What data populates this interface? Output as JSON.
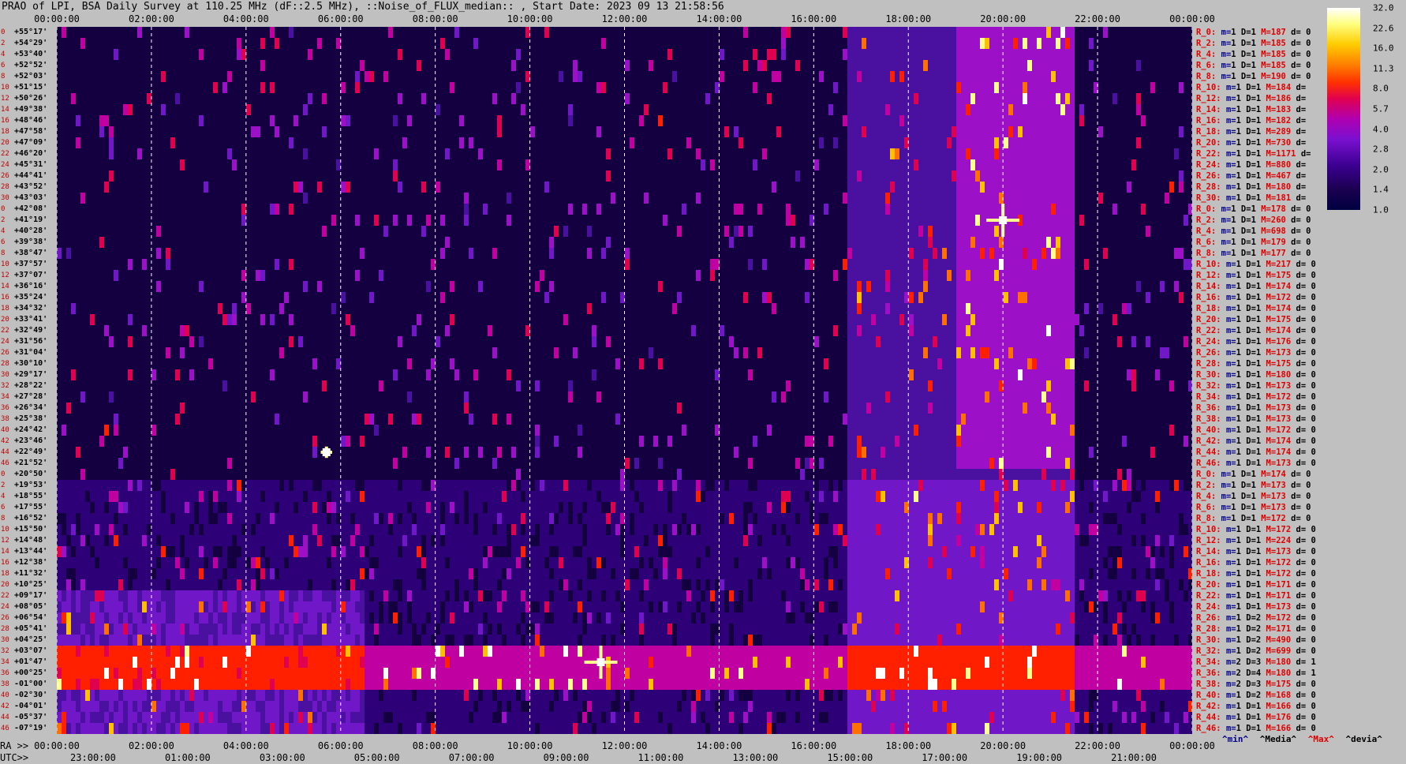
{
  "title": "PRAO of LPI, BSA Daily Survey at 110.25 MHz (dF::2.5 MHz), ::Noise_of_FLUX_median:: , Start Date: 2023 09 13 21:58:56",
  "top_ticks": [
    "00:00:00",
    "02:00:00",
    "04:00:00",
    "06:00:00",
    "08:00:00",
    "10:00:00",
    "12:00:00",
    "14:00:00",
    "16:00:00",
    "18:00:00",
    "20:00:00",
    "22:00:00",
    "00:00:00"
  ],
  "bottom_ra_prefix": "RA >>",
  "bottom_ra_ticks": [
    "00:00:00",
    "02:00:00",
    "04:00:00",
    "06:00:00",
    "08:00:00",
    "10:00:00",
    "12:00:00",
    "14:00:00",
    "16:00:00",
    "18:00:00",
    "20:00:00",
    "22:00:00",
    "00:00:00"
  ],
  "bottom_utc_prefix": "UTC>>",
  "bottom_utc_ticks": [
    "23:00:00",
    "01:00:00",
    "03:00:00",
    "05:00:00",
    "07:00:00",
    "09:00:00",
    "11:00:00",
    "13:00:00",
    "15:00:00",
    "17:00:00",
    "19:00:00",
    "21:00:00"
  ],
  "legend": {
    "min": "^min^",
    "media": "^Media^",
    "max": "^Max^",
    "devia": "^devia^"
  },
  "legend_colors": {
    "min": "#00008b",
    "media": "#000000",
    "max": "#e00000",
    "devia": "#000000"
  },
  "colorbar": {
    "labels": [
      "32.0",
      "22.6",
      "16.0",
      "11.3",
      "8.0",
      "5.7",
      "4.0",
      "2.8",
      "2.0",
      "1.4",
      "1.0"
    ]
  },
  "declinations": [
    "+55°17'",
    "+54°29'",
    "+53°40'",
    "+52°52'",
    "+52°03'",
    "+51°15'",
    "+50°26'",
    "+49°38'",
    "+48°46'",
    "+47°58'",
    "+47°09'",
    "+46°20'",
    "+45°31'",
    "+44°41'",
    "+43°52'",
    "+43°03'",
    "+42°08'",
    "+41°19'",
    "+40°28'",
    "+39°38'",
    "+38°47'",
    "+37°57'",
    "+37°07'",
    "+36°16'",
    "+35°24'",
    "+34°32'",
    "+33°41'",
    "+32°49'",
    "+31°56'",
    "+31°04'",
    "+30°10'",
    "+29°17'",
    "+28°22'",
    "+27°28'",
    "+26°34'",
    "+25°38'",
    "+24°42'",
    "+23°46'",
    "+22°49'",
    "+21°52'",
    "+20°50'",
    "+19°53'",
    "+18°55'",
    "+17°55'",
    "+16°52'",
    "+15°50'",
    "+14°48'",
    "+13°44'",
    "+12°38'",
    "+11°32'",
    "+10°25'",
    "+09°17'",
    "+08°05'",
    "+06°54'",
    "+05°41'",
    "+04°25'",
    "+03°07'",
    "+01°47'",
    "+00°25'",
    "-01°00'",
    "-02°30'",
    "-04°01'",
    "-05°37'",
    "-07°19'"
  ],
  "row_numbers": [
    "0",
    "2",
    "4",
    "6",
    "8",
    "10",
    "12",
    "14",
    "16",
    "18",
    "20",
    "22",
    "24",
    "26",
    "28",
    "30",
    "0",
    "2",
    "4",
    "6",
    "8",
    "10",
    "12",
    "14",
    "16",
    "18",
    "20",
    "22",
    "24",
    "26",
    "28",
    "30",
    "32",
    "34",
    "36",
    "38",
    "40",
    "42",
    "44",
    "46",
    "0",
    "2",
    "4",
    "6",
    "8",
    "10",
    "12",
    "14",
    "16",
    "18",
    "20",
    "22",
    "24",
    "26",
    "28",
    "30",
    "32",
    "34",
    "36",
    "38",
    "40",
    "42",
    "44",
    "46"
  ],
  "stats": [
    {
      "r": "R_0:",
      "m": "1",
      "D": "1",
      "M": "187",
      "d": "0"
    },
    {
      "r": "R_2:",
      "m": "1",
      "D": "1",
      "M": "185",
      "d": "0"
    },
    {
      "r": "R_4:",
      "m": "1",
      "D": "1",
      "M": "185",
      "d": "0"
    },
    {
      "r": "R_6:",
      "m": "1",
      "D": "1",
      "M": "185",
      "d": "0"
    },
    {
      "r": "R_8:",
      "m": "1",
      "D": "1",
      "M": "190",
      "d": "0"
    },
    {
      "r": "R_10:",
      "m": "1",
      "D": "1",
      "M": "184",
      "d": ""
    },
    {
      "r": "R_12:",
      "m": "1",
      "D": "1",
      "M": "186",
      "d": ""
    },
    {
      "r": "R_14:",
      "m": "1",
      "D": "1",
      "M": "183",
      "d": ""
    },
    {
      "r": "R_16:",
      "m": "1",
      "D": "1",
      "M": "182",
      "d": ""
    },
    {
      "r": "R_18:",
      "m": "1",
      "D": "1",
      "M": "289",
      "d": ""
    },
    {
      "r": "R_20:",
      "m": "1",
      "D": "1",
      "M": "730",
      "d": ""
    },
    {
      "r": "R_22:",
      "m": "1",
      "D": "1",
      "M": "1171",
      "d": ""
    },
    {
      "r": "R_24:",
      "m": "1",
      "D": "1",
      "M": "880",
      "d": ""
    },
    {
      "r": "R_26:",
      "m": "1",
      "D": "1",
      "M": "467",
      "d": ""
    },
    {
      "r": "R_28:",
      "m": "1",
      "D": "1",
      "M": "180",
      "d": ""
    },
    {
      "r": "R_30:",
      "m": "1",
      "D": "1",
      "M": "181",
      "d": ""
    },
    {
      "r": "R_0:",
      "m": "1",
      "D": "1",
      "M": "178",
      "d": "0"
    },
    {
      "r": "R_2:",
      "m": "1",
      "D": "1",
      "M": "260",
      "d": "0"
    },
    {
      "r": "R_4:",
      "m": "1",
      "D": "1",
      "M": "698",
      "d": "0"
    },
    {
      "r": "R_6:",
      "m": "1",
      "D": "1",
      "M": "179",
      "d": "0"
    },
    {
      "r": "R_8:",
      "m": "1",
      "D": "1",
      "M": "177",
      "d": "0"
    },
    {
      "r": "R_10:",
      "m": "1",
      "D": "1",
      "M": "217",
      "d": "0"
    },
    {
      "r": "R_12:",
      "m": "1",
      "D": "1",
      "M": "175",
      "d": "0"
    },
    {
      "r": "R_14:",
      "m": "1",
      "D": "1",
      "M": "174",
      "d": "0"
    },
    {
      "r": "R_16:",
      "m": "1",
      "D": "1",
      "M": "172",
      "d": "0"
    },
    {
      "r": "R_18:",
      "m": "1",
      "D": "1",
      "M": "174",
      "d": "0"
    },
    {
      "r": "R_20:",
      "m": "1",
      "D": "1",
      "M": "175",
      "d": "0"
    },
    {
      "r": "R_22:",
      "m": "1",
      "D": "1",
      "M": "174",
      "d": "0"
    },
    {
      "r": "R_24:",
      "m": "1",
      "D": "1",
      "M": "176",
      "d": "0"
    },
    {
      "r": "R_26:",
      "m": "1",
      "D": "1",
      "M": "173",
      "d": "0"
    },
    {
      "r": "R_28:",
      "m": "1",
      "D": "1",
      "M": "175",
      "d": "0"
    },
    {
      "r": "R_30:",
      "m": "1",
      "D": "1",
      "M": "180",
      "d": "0"
    },
    {
      "r": "R_32:",
      "m": "1",
      "D": "1",
      "M": "173",
      "d": "0"
    },
    {
      "r": "R_34:",
      "m": "1",
      "D": "1",
      "M": "172",
      "d": "0"
    },
    {
      "r": "R_36:",
      "m": "1",
      "D": "1",
      "M": "173",
      "d": "0"
    },
    {
      "r": "R_38:",
      "m": "1",
      "D": "1",
      "M": "173",
      "d": "0"
    },
    {
      "r": "R_40:",
      "m": "1",
      "D": "1",
      "M": "172",
      "d": "0"
    },
    {
      "r": "R_42:",
      "m": "1",
      "D": "1",
      "M": "174",
      "d": "0"
    },
    {
      "r": "R_44:",
      "m": "1",
      "D": "1",
      "M": "174",
      "d": "0"
    },
    {
      "r": "R_46:",
      "m": "1",
      "D": "1",
      "M": "173",
      "d": "0"
    },
    {
      "r": "R_0:",
      "m": "1",
      "D": "1",
      "M": "174",
      "d": "0"
    },
    {
      "r": "R_2:",
      "m": "1",
      "D": "1",
      "M": "173",
      "d": "0"
    },
    {
      "r": "R_4:",
      "m": "1",
      "D": "1",
      "M": "173",
      "d": "0"
    },
    {
      "r": "R_6:",
      "m": "1",
      "D": "1",
      "M": "173",
      "d": "0"
    },
    {
      "r": "R_8:",
      "m": "1",
      "D": "1",
      "M": "172",
      "d": "0"
    },
    {
      "r": "R_10:",
      "m": "1",
      "D": "1",
      "M": "172",
      "d": "0"
    },
    {
      "r": "R_12:",
      "m": "1",
      "D": "1",
      "M": "224",
      "d": "0"
    },
    {
      "r": "R_14:",
      "m": "1",
      "D": "1",
      "M": "173",
      "d": "0"
    },
    {
      "r": "R_16:",
      "m": "1",
      "D": "1",
      "M": "172",
      "d": "0"
    },
    {
      "r": "R_18:",
      "m": "1",
      "D": "1",
      "M": "172",
      "d": "0"
    },
    {
      "r": "R_20:",
      "m": "1",
      "D": "1",
      "M": "171",
      "d": "0"
    },
    {
      "r": "R_22:",
      "m": "1",
      "D": "1",
      "M": "171",
      "d": "0"
    },
    {
      "r": "R_24:",
      "m": "1",
      "D": "1",
      "M": "173",
      "d": "0"
    },
    {
      "r": "R_26:",
      "m": "1",
      "D": "2",
      "M": "172",
      "d": "0"
    },
    {
      "r": "R_28:",
      "m": "1",
      "D": "2",
      "M": "171",
      "d": "0"
    },
    {
      "r": "R_30:",
      "m": "1",
      "D": "2",
      "M": "490",
      "d": "0"
    },
    {
      "r": "R_32:",
      "m": "1",
      "D": "2",
      "M": "699",
      "d": "0"
    },
    {
      "r": "R_34:",
      "m": "2",
      "D": "3",
      "M": "180",
      "d": "1"
    },
    {
      "r": "R_36:",
      "m": "2",
      "D": "4",
      "M": "180",
      "d": "1"
    },
    {
      "r": "R_38:",
      "m": "2",
      "D": "3",
      "M": "175",
      "d": "0"
    },
    {
      "r": "R_40:",
      "m": "1",
      "D": "2",
      "M": "168",
      "d": "0"
    },
    {
      "r": "R_42:",
      "m": "1",
      "D": "1",
      "M": "166",
      "d": "0"
    },
    {
      "r": "R_44:",
      "m": "1",
      "D": "1",
      "M": "176",
      "d": "0"
    },
    {
      "r": "R_46:",
      "m": "1",
      "D": "1",
      "M": "166",
      "d": "0"
    }
  ],
  "chart_data": {
    "type": "heatmap",
    "title": "PRAO of LPI, BSA Daily Survey at 110.25 MHz (dF::2.5 MHz), ::Noise_of_FLUX_median:: , Start Date: 2023 09 13 21:58:56",
    "x_axis": {
      "ra_hours": [
        0,
        24
      ],
      "ticks_ra": [
        "00:00:00",
        "02:00:00",
        "04:00:00",
        "06:00:00",
        "08:00:00",
        "10:00:00",
        "12:00:00",
        "14:00:00",
        "16:00:00",
        "18:00:00",
        "20:00:00",
        "22:00:00",
        "00:00:00"
      ]
    },
    "y_axis": {
      "dec_range": [
        "+55°17'",
        "-07°19'"
      ]
    },
    "colorbar_range": [
      1.0,
      32.0
    ],
    "features": [
      {
        "name": "bright source",
        "ra": "11:30",
        "dec": "+03°07'",
        "intensity": 32
      },
      {
        "name": "bright source",
        "ra": "20:00",
        "dec": "+41°19'",
        "intensity": 32
      },
      {
        "name": "bright source",
        "ra": "05:40",
        "dec": "+22°49'",
        "intensity": 11
      },
      {
        "name": "galactic plane band",
        "ra_start": "17:00",
        "ra_end": "21:00",
        "dec_start": "-07°19'",
        "dec_end": "+55°17'"
      },
      {
        "name": "low-dec band",
        "dec": "+00°25'",
        "ra_start": "00:00",
        "ra_end": "24:00"
      }
    ]
  }
}
